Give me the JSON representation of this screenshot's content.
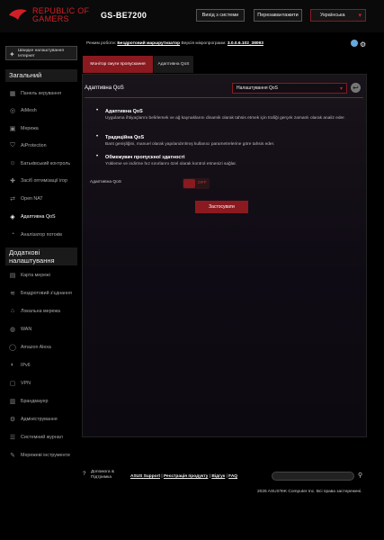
{
  "header": {
    "brand_line1": "REPUBLIC OF",
    "brand_line2": "GAMERS",
    "model": "GS-BE7200",
    "logout": "Вихід з системи",
    "reboot": "Перезавантажити",
    "language": "Українська"
  },
  "status": {
    "mode_label": "Режим роботи:",
    "mode_value": "Бездротовий маршрутизатор",
    "firmware_label": "Версія мікропрограми:",
    "firmware_value": "3.0.0.6.102_38093"
  },
  "sidebar": {
    "quick_setup": "Швидке налаштування Інтернет",
    "section_general": "Загальний",
    "general_items": [
      {
        "label": "Панель керування",
        "icon": "dashboard-icon"
      },
      {
        "label": "AiMesh",
        "icon": "aimesh-icon"
      },
      {
        "label": "Мережа",
        "icon": "network-icon"
      },
      {
        "label": "AiProtection",
        "icon": "shield-icon"
      },
      {
        "label": "Батьківський контроль",
        "icon": "parental-icon"
      },
      {
        "label": "Засіб оптимізації ігор",
        "icon": "gamepad-icon"
      },
      {
        "label": "Open NAT",
        "icon": "nat-icon"
      },
      {
        "label": "Адаптивна QoS",
        "icon": "qos-icon"
      },
      {
        "label": "Аналізатор потоків",
        "icon": "analyzer-icon"
      }
    ],
    "section_advanced": "Додаткові налаштування",
    "advanced_items": [
      {
        "label": "Карта мережі",
        "icon": "map-icon"
      },
      {
        "label": "Бездротовий з'єднання",
        "icon": "wifi-icon"
      },
      {
        "label": "Локальна мережа",
        "icon": "lan-icon"
      },
      {
        "label": "WAN",
        "icon": "globe-icon"
      },
      {
        "label": "Amazon Alexa",
        "icon": "alexa-icon"
      },
      {
        "label": "IPv6",
        "icon": "ipv6-icon"
      },
      {
        "label": "VPN",
        "icon": "vpn-icon"
      },
      {
        "label": "Брандмауер",
        "icon": "firewall-icon"
      },
      {
        "label": "Адміністрування",
        "icon": "admin-icon"
      },
      {
        "label": "Системний журнал",
        "icon": "log-icon"
      },
      {
        "label": "Мережеві інструменти",
        "icon": "tools-icon"
      }
    ]
  },
  "tabs": {
    "monitor": "Монітор смуги пропускання",
    "qos": "Адаптивна QoS"
  },
  "panel": {
    "title": "Адаптивна QoS",
    "select_value": "Налаштування QoS",
    "bullets": [
      {
        "title": "Адаптивна QoS",
        "desc": "Uygulama ihtiyaçlarını belirlemek ve ağ kaynaklarını dinamik olarak tahsis etmek için trafiği gerçek zamanlı olarak analiz eder."
      },
      {
        "title": "Традиційна QoS",
        "desc": "Bant genişliğini, manuel olarak yapılandırılmış kullanıcı parametrelerine göre tahsis eder."
      },
      {
        "title": "Обмежувач пропускної здатності",
        "desc": "Yükleme ve indirme hız sınırlarını özel olarak kontrol etmenizi sağlar."
      }
    ],
    "qos_label": "Адаптивна QoS",
    "toggle_label": "OFF",
    "apply": "Застосувати"
  },
  "footer": {
    "help": "Допомога & Підтримка",
    "link_support": "ASUS Support",
    "link_register": "Реєстрація продукту",
    "link_feedback": "Відгук",
    "link_faq": "FAQ",
    "copyright": "2026 ASUSTeK Computer Inc. Всі права застережені."
  }
}
